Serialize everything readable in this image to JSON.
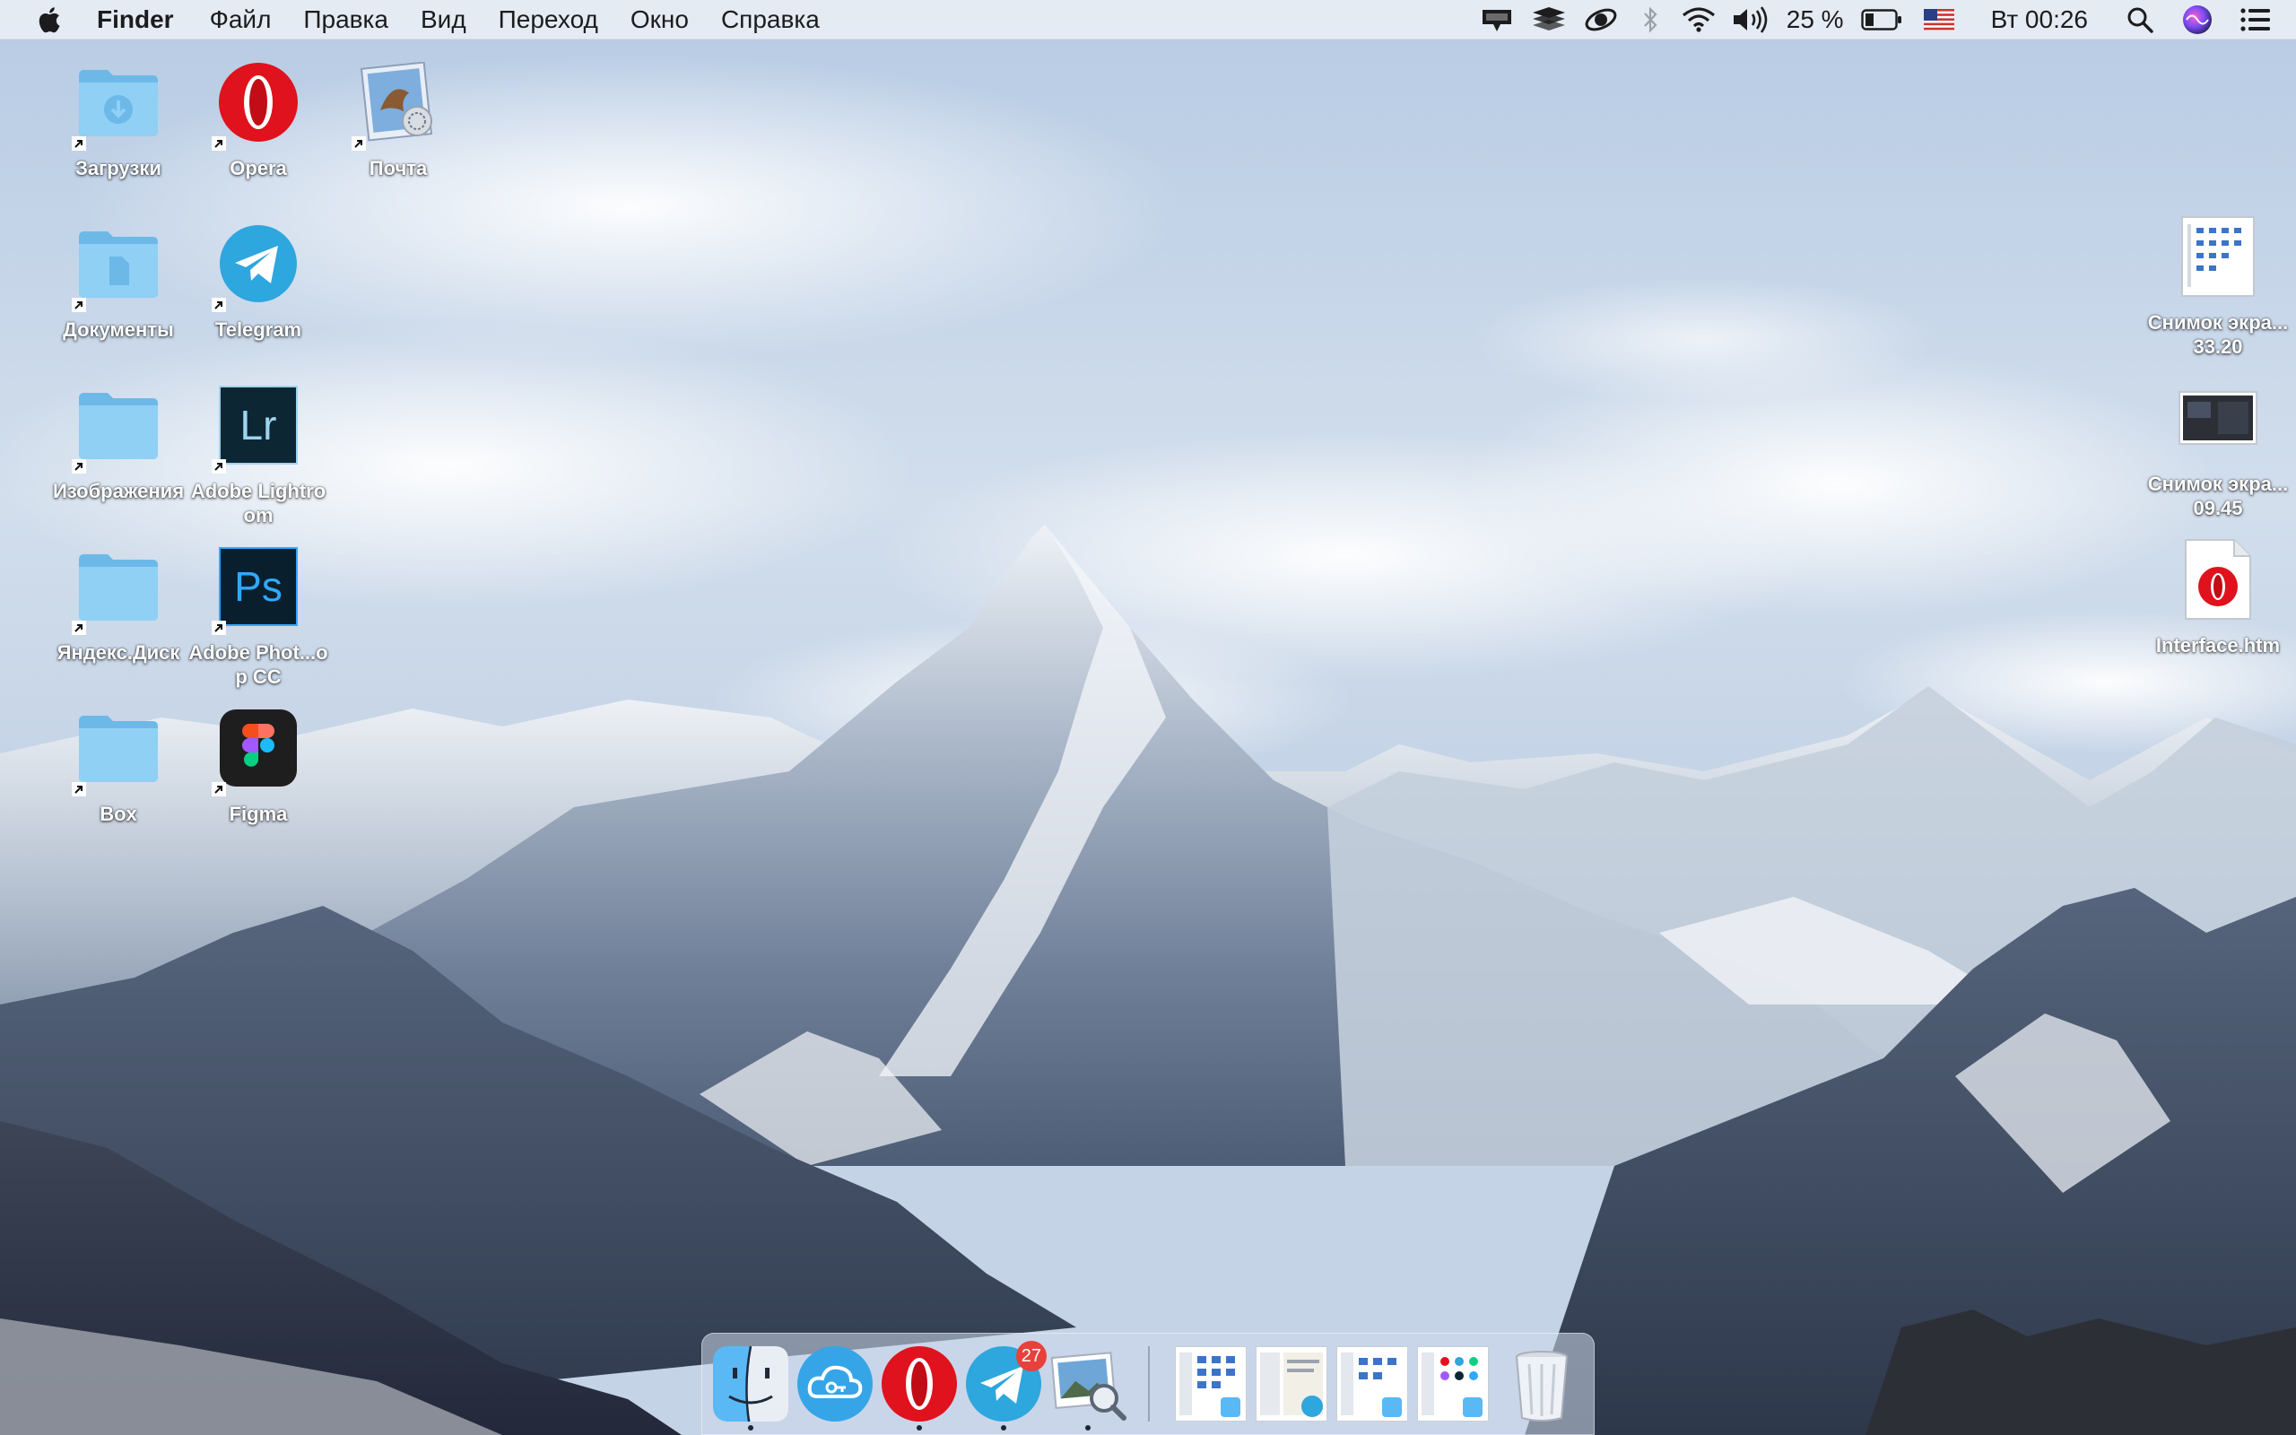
{
  "menubar": {
    "app_name": "Finder",
    "menus": [
      "Файл",
      "Правка",
      "Вид",
      "Переход",
      "Окно",
      "Справка"
    ],
    "battery_percent": "25 %",
    "clock": "Вт 00:26",
    "status_icons": [
      "airdrop-like-icon",
      "stack-icon",
      "app-status-icon",
      "bluetooth-icon",
      "wifi-icon",
      "volume-icon",
      "battery-icon",
      "us-flag-icon",
      "search-icon",
      "siri-icon",
      "notification-center-icon"
    ]
  },
  "desktop": {
    "left_icons": [
      {
        "label": "Загрузки",
        "icon": "downloads-folder-icon"
      },
      {
        "label": "Opera",
        "icon": "opera-icon"
      },
      {
        "label": "Почта",
        "icon": "mail-icon"
      },
      {
        "label": "Документы",
        "icon": "documents-folder-icon"
      },
      {
        "label": "Telegram",
        "icon": "telegram-icon"
      },
      {
        "label": "Изображения",
        "icon": "folder-icon"
      },
      {
        "label": "Adobe Lightroom",
        "icon": "lightroom-icon",
        "glyph": "Lr"
      },
      {
        "label": "Яндекс.Диск",
        "icon": "folder-icon"
      },
      {
        "label": "Adobe Phot...op CC",
        "icon": "photoshop-icon",
        "glyph": "Ps"
      },
      {
        "label": "Box",
        "icon": "folder-icon"
      },
      {
        "label": "Figma",
        "icon": "figma-icon"
      }
    ],
    "right_icons": [
      {
        "label": "Снимок экра...33.20",
        "icon": "screenshot-file-icon"
      },
      {
        "label": "Снимок экра...09.45",
        "icon": "screenshot-file-icon"
      },
      {
        "label": "Interface.htm",
        "icon": "opera-html-file-icon"
      }
    ]
  },
  "dock": {
    "apps": [
      {
        "name": "Finder",
        "icon": "finder-icon",
        "running": true
      },
      {
        "name": "Cloud",
        "icon": "cloud-key-icon",
        "running": false
      },
      {
        "name": "Opera",
        "icon": "opera-icon",
        "running": true
      },
      {
        "name": "Telegram",
        "icon": "telegram-icon",
        "running": true,
        "badge": "27"
      },
      {
        "name": "Preview",
        "icon": "preview-icon",
        "running": true
      }
    ],
    "stacks": [
      "window-thumbnail-icon",
      "window-thumbnail-icon",
      "window-thumbnail-icon",
      "window-thumbnail-icon",
      "trash-icon"
    ]
  },
  "colors": {
    "folder": "#7fc6f0",
    "opera_red": "#e0121d",
    "telegram_blue": "#2ea6de",
    "lightroom_bg": "#0c2733",
    "lightroom_fg": "#9fd3ee",
    "photoshop_bg": "#0a1f2e",
    "photoshop_fg": "#31a8ff",
    "badge_red": "#e8413c"
  }
}
